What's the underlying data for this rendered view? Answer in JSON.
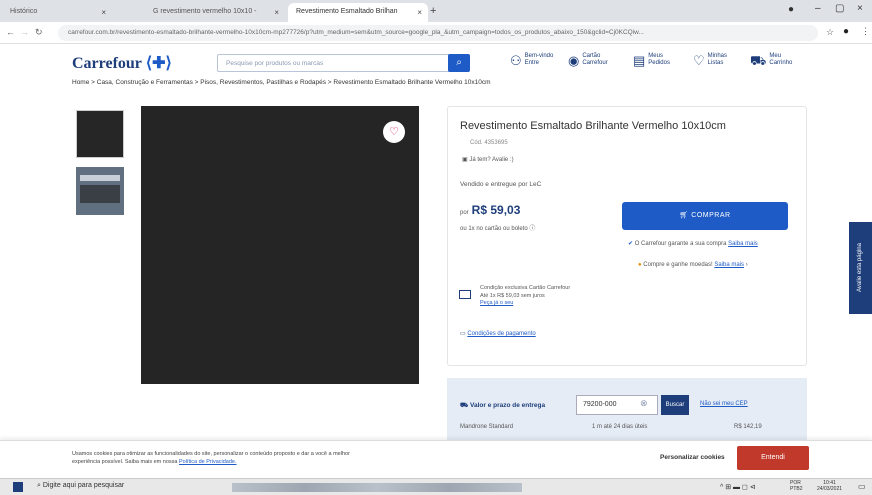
{
  "browser": {
    "tabs": [
      {
        "label": "Histórico"
      },
      {
        "label": "G revestimento vermelho 10x10 - "
      },
      {
        "label": "Revestimento Esmaltado Brilhan"
      }
    ],
    "new_tab": "+",
    "url": "carrefour.com.br/revestimento-esmaltado-brilhante-vermelho-10x10cm-mp277726/p?utm_medium=sem&utm_source=google_pla_&utm_campaign=todos_os_produtos_abaixo_150&gclid=Cj0KCQiw..."
  },
  "header": {
    "logo": "Carrefour",
    "search_placeholder": "Pesquise por produtos ou marcas",
    "icons": [
      {
        "name": "account",
        "label1": "Bem-vindo",
        "label2": "Entre"
      },
      {
        "name": "cartao",
        "label1": "Cartão",
        "label2": "Carrefour"
      },
      {
        "name": "pedidos",
        "label1": "Meus",
        "label2": "Pedidos"
      },
      {
        "name": "listas",
        "label1": "Minhas",
        "label2": "Listas"
      },
      {
        "name": "carrinho",
        "label1": "Meu",
        "label2": "Carrinho"
      }
    ]
  },
  "breadcrumb": "Home > Casa, Construção e Ferramentas > Pisos, Revestimentos, Pastilhas e Rodapés > Revestimento Esmaltado Brilhante Vermelho 10x10cm",
  "product": {
    "title": "Revestimento Esmaltado Brilhante Vermelho 10x10cm",
    "code": "Cód. 4353695",
    "review": "Já tem? Avalie :)",
    "seller": "Vendido e entregue por LeC",
    "price_prefix": "por",
    "price": "R$ 59,03",
    "installments": "ou 1x no cartão ou boleto",
    "buy": "COMPRAR",
    "guarantee": "O Carrefour garante a sua compra",
    "guarantee_link": "Saiba mais",
    "cashback": "Compre e ganhe moedas!",
    "cashback_link": "Saiba mais",
    "card_line1": "Condição exclusiva Cartão Carrefour",
    "card_line2": "Até 1x R$ 59,03 sem juros",
    "card_link": "Peça já o seu",
    "payment_link": "Condições de pagamento"
  },
  "shipping": {
    "label": "Valor e prazo de entrega",
    "cep": "79200-000",
    "search": "Buscar",
    "no_cep": "Não sei meu CEP",
    "method": "Mandrone Standard",
    "days": "1 m até 24 dias úteis",
    "cost": "R$ 142,19"
  },
  "cookie": {
    "text1": "Usamos cookies para otimizar as funcionalidades do site, personalizar o conteúdo proposto e dar a você a melhor",
    "text2": "experiência possível. Saiba mais em nossa",
    "policy": "Política de Privacidade.",
    "personalize": "Personalizar cookies",
    "accept": "Entendi"
  },
  "sidetab": "Avalie esta página",
  "taskbar": {
    "search": "Digite aqui para pesquisar",
    "lang1": "POR",
    "lang2": "PTB2",
    "time": "10:41",
    "date": "24/03/2021"
  },
  "colors": {
    "brand_blue": "#1e5bc6",
    "brand_navy": "#1e3e7b",
    "accept_red": "#c0392b"
  }
}
